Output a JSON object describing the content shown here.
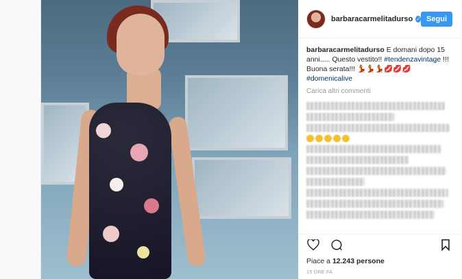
{
  "post": {
    "username": "barbaracarmelitadurso",
    "follow_label": "Segui",
    "caption_user": "barbaracarmelitadurso",
    "caption_text": " E domani dopo 15 anni..... Questo vestito!! ",
    "caption_tag1": "#tendenzavintage",
    "caption_text2": " !!! Buona serata!!! 💃💃💃💋💋💋",
    "caption_tag2": "#domenicalive",
    "load_more": "Carica altri commenti",
    "likes_prefix": "Piace a ",
    "likes_count": "12.243 persone",
    "timestamp": "15 ORE FA"
  },
  "colors": {
    "accent": "#3897f0",
    "hashtag": "#003569",
    "text": "#262626",
    "muted": "#999999"
  },
  "icons": [
    "verified-badge-icon",
    "heart-icon",
    "comment-icon",
    "bookmark-icon"
  ]
}
